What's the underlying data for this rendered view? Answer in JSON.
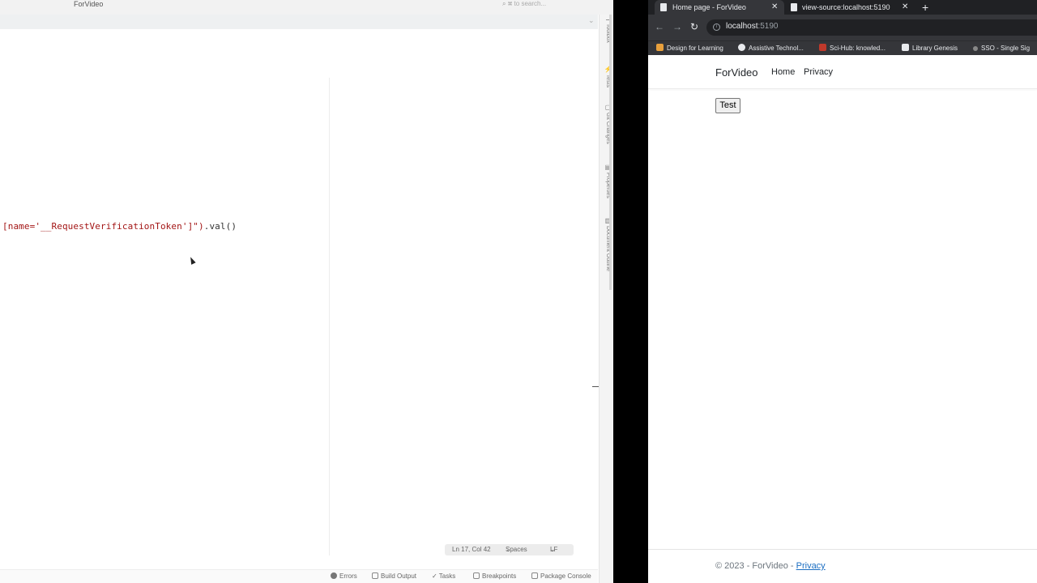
{
  "ide": {
    "title": "ForVideo",
    "search_placeholder": "to search...",
    "code_line": {
      "string_part": "[name='__RequestVerificationToken']\")",
      "tail": ".val()"
    },
    "rail_items": [
      "Toolbox",
      "Tests",
      "Git Changes",
      "Properties",
      "Document Outline"
    ],
    "status": {
      "position": "Ln 17, Col 42",
      "indent": "Spaces",
      "line_ending": "LF"
    },
    "bottom_tools": [
      "Errors",
      "Build Output",
      "Tasks",
      "Breakpoints",
      "Package Console"
    ]
  },
  "browser": {
    "tabs": [
      {
        "label": "Home page - ForVideo",
        "active": true
      },
      {
        "label": "view-source:localhost:5190",
        "active": false
      }
    ],
    "url_host": "localhost",
    "url_port": ":5190",
    "bookmarks": [
      {
        "label": "Design for Learning",
        "color": "#e8a03c"
      },
      {
        "label": "Assistive Technol...",
        "color": "#e8eaed"
      },
      {
        "label": "Sci-Hub: knowled...",
        "color": "#c0392b"
      },
      {
        "label": "Library Genesis",
        "color": "#e8eaed"
      },
      {
        "label": "SSO - Single Sig",
        "color": "#888888"
      }
    ]
  },
  "site": {
    "brand": "ForVideo",
    "nav": [
      "Home",
      "Privacy"
    ],
    "button_label": "Test",
    "footer_text": "© 2023 - ForVideo - ",
    "footer_link": "Privacy"
  }
}
